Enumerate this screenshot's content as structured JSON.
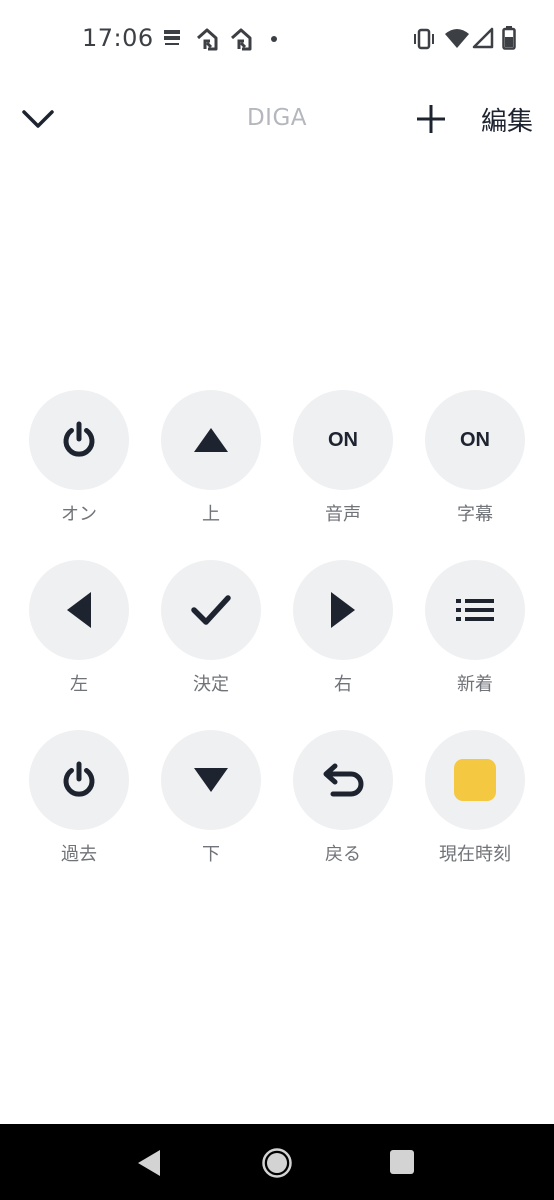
{
  "status_bar": {
    "time": "17:06",
    "icons": [
      "sim-icon",
      "home-icon",
      "home-icon",
      "dot-icon",
      "vibrate-icon",
      "wifi-icon",
      "signal-icon",
      "battery-icon"
    ]
  },
  "header": {
    "back_icon": "chevron-down-icon",
    "title": "DIGA",
    "add_icon": "plus-icon",
    "edit_label": "編集"
  },
  "buttons": [
    {
      "label": "オン",
      "icon": "power-icon"
    },
    {
      "label": "上",
      "icon": "triangle-up-icon"
    },
    {
      "label": "音声",
      "icon_text": "ON"
    },
    {
      "label": "字幕",
      "icon_text": "ON"
    },
    {
      "label": "左",
      "icon": "triangle-left-icon"
    },
    {
      "label": "決定",
      "icon": "checkmark-icon"
    },
    {
      "label": "右",
      "icon": "triangle-right-icon"
    },
    {
      "label": "新着",
      "icon": "list-icon"
    },
    {
      "label": "過去",
      "icon": "power-icon"
    },
    {
      "label": "下",
      "icon": "triangle-down-icon"
    },
    {
      "label": "戻る",
      "icon": "return-icon"
    },
    {
      "label": "現在時刻",
      "icon": "yellow-square-icon"
    }
  ],
  "nav_bar": {
    "icons": [
      "back-triangle-icon",
      "home-circle-icon",
      "recents-square-icon"
    ]
  },
  "colors": {
    "button_bg": "#eff0f2",
    "icon": "#1e2330",
    "label": "#707378",
    "title": "#b4b7bd",
    "accent_yellow": "#f5c842"
  }
}
